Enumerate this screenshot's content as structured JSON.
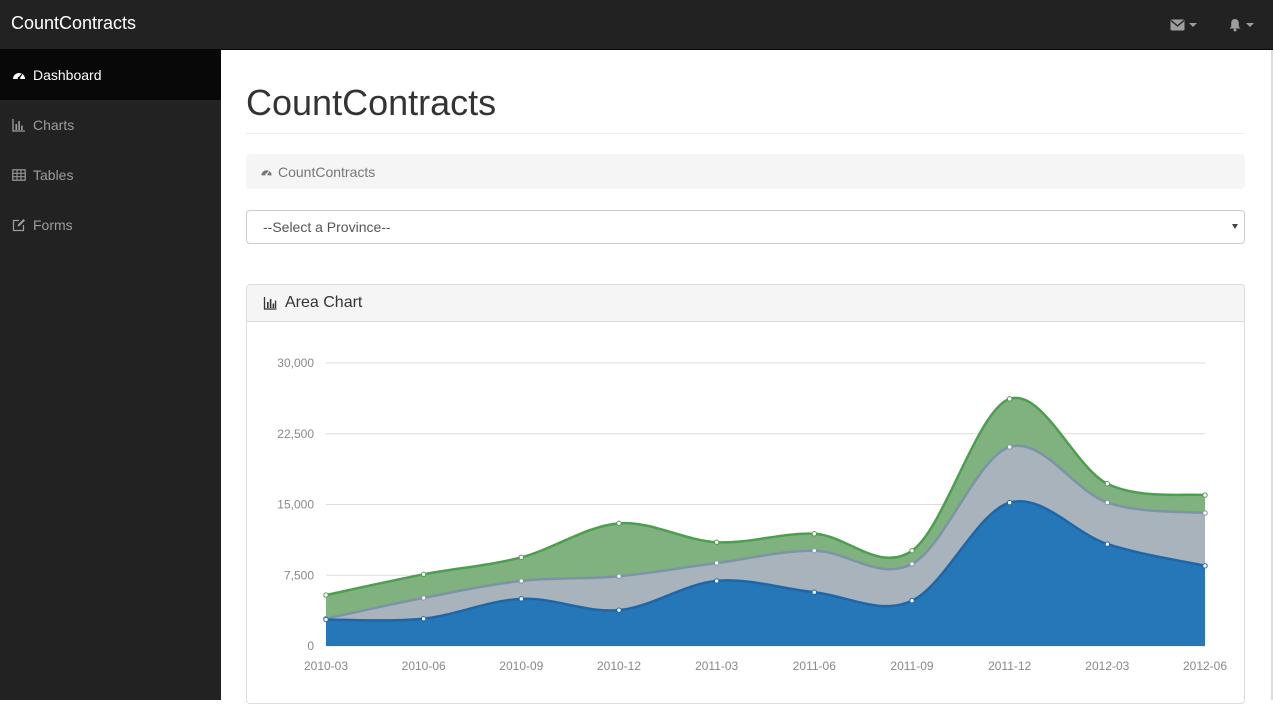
{
  "navbar": {
    "brand": "CountContracts",
    "icons": [
      "envelope-icon",
      "bell-icon"
    ]
  },
  "sidebar": {
    "items": [
      {
        "label": "Dashboard",
        "icon": "dashboard-icon",
        "active": true
      },
      {
        "label": "Charts",
        "icon": "bar-chart-icon",
        "active": false
      },
      {
        "label": "Tables",
        "icon": "table-icon",
        "active": false
      },
      {
        "label": "Forms",
        "icon": "edit-icon",
        "active": false
      }
    ]
  },
  "main": {
    "title": "CountContracts",
    "breadcrumb": "CountContracts",
    "province_select": "--Select a Province--"
  },
  "panel": {
    "title": "Area Chart"
  },
  "colors": {
    "series_blue": "#2677b8",
    "series_gray": "#a8b3bb",
    "series_green": "#7fb27e",
    "navbar_bg": "#222222"
  },
  "chart_data": {
    "type": "area",
    "stacked": true,
    "categories": [
      "2010-03",
      "2010-06",
      "2010-09",
      "2010-12",
      "2011-03",
      "2011-06",
      "2011-09",
      "2011-12",
      "2012-03",
      "2012-06"
    ],
    "yticks": [
      "0",
      "7,500",
      "15,000",
      "22,500",
      "30,000"
    ],
    "ylim": [
      0,
      30000
    ],
    "grid": true,
    "series": [
      {
        "values": [
          2800,
          2900,
          5000,
          3800,
          6900,
          5700,
          4800,
          15200,
          10800,
          8500
        ],
        "color": "#2677b8"
      },
      {
        "values": [
          100,
          2200,
          1900,
          3600,
          1900,
          4400,
          3900,
          5900,
          4400,
          5600
        ],
        "color": "#a8b3bb"
      },
      {
        "values": [
          2500,
          2500,
          2500,
          5600,
          2200,
          1800,
          1400,
          5100,
          2000,
          1900
        ],
        "color": "#7fb27e"
      }
    ]
  }
}
